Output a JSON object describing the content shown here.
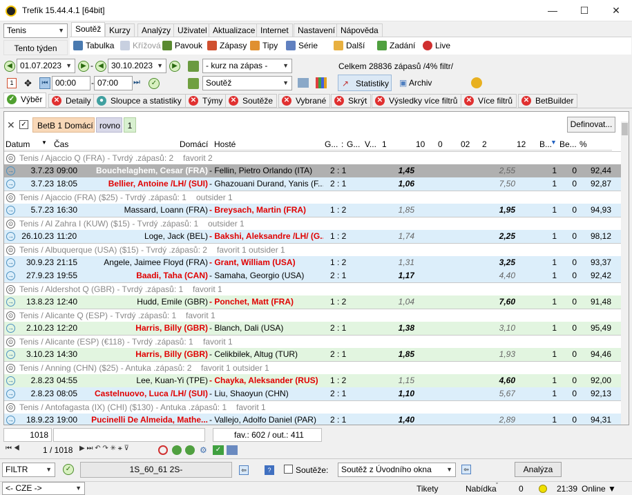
{
  "window": {
    "title": "Trefík 15.44.4.1 [64bit]"
  },
  "sport": {
    "value": "Tenis"
  },
  "week_label": "Tento týden",
  "tabs": [
    "Soutěž",
    "Kurzy",
    "Analýzy",
    "Uživatel",
    "Aktualizace",
    "Internet",
    "Nastavení",
    "Nápověda"
  ],
  "ribbon": [
    "Tabulka",
    "Křížová",
    "Pavouk",
    "Zápasy",
    "Tipy",
    "Série",
    "Další",
    "Zadání",
    "Live"
  ],
  "dates": {
    "from": "01.07.2023",
    "to": "30.10.2023",
    "time_from": "00:00",
    "time_to": "07:00"
  },
  "kurz_select": "- kurz na zápas -",
  "soutez_select": "Soutěž",
  "summary": "Celkem 28836 zápasů /4% filtr/",
  "stats_btn": "Statistiky",
  "archiv_btn": "Archiv",
  "filter_tabs": [
    "Výběr",
    "Detaily",
    "Sloupce a statistiky",
    "Týmy",
    "Soutěže",
    "Vybrané",
    "Skrýt",
    "Výsledky více filtrů",
    "Více filtrů",
    "BetBuilder"
  ],
  "chips": {
    "c1": "BetB 1 Domácí",
    "c2": "rovno",
    "c3": "1",
    "define_btn": "Definovat..."
  },
  "columns": [
    "Datum",
    "Čas",
    "Domácí",
    "Hosté",
    "G...",
    ":",
    "G...",
    "V...",
    "1",
    "10",
    "0",
    "02",
    "2",
    "12",
    "B...",
    "Be...",
    "%"
  ],
  "rows": [
    {
      "t": "g",
      "text": "Tenis / Ajaccio Q (FRA) - Tvrdý .zápasů: 2",
      "extra": "favorit 2"
    },
    {
      "t": "m",
      "bg": "sel",
      "d": "3.7.23",
      "time": "09:00",
      "home": "Bouchelaghem, Cesar (FRA)",
      "away": "- Fellin, Pietro Orlando (ITA)",
      "score": "2 : 1",
      "k1": "1,45",
      "k2": "2,55",
      "b": "1",
      "be": "0",
      "pct": "92,44",
      "hr": false,
      "ar": false,
      "k1b": true,
      "k2b": false,
      "hw": true
    },
    {
      "t": "m",
      "bg": "blue",
      "d": "3.7.23",
      "time": "18:05",
      "home": "Bellier, Antoine /LH/ (SUI)",
      "away": "- Ghazouani Durand, Yanis (F...",
      "score": "2 : 1",
      "k1": "1,06",
      "k2": "7,50",
      "b": "1",
      "be": "0",
      "pct": "92,87",
      "hr": true,
      "ar": false,
      "k1b": true,
      "k2b": false
    },
    {
      "t": "g",
      "text": "Tenis / Ajaccio (FRA) ($25) - Tvrdý .zápasů: 1",
      "extra": "outsider 1"
    },
    {
      "t": "m",
      "bg": "blue",
      "d": "5.7.23",
      "time": "16:30",
      "home": "Massard, Loann (FRA)",
      "away": "- Breysach, Martin (FRA)",
      "score": "1 : 2",
      "k1": "1,85",
      "k2": "1,95",
      "b": "1",
      "be": "0",
      "pct": "94,93",
      "hr": false,
      "ar": true,
      "k1b": false,
      "k2b": true
    },
    {
      "t": "g",
      "text": "Tenis / Al Zahra I (KUW) ($15) - Tvrdý .zápasů: 1",
      "extra": "outsider 1"
    },
    {
      "t": "m",
      "bg": "blue",
      "d": "26.10.23",
      "time": "11:20",
      "home": "Loge, Jack (BEL)",
      "away": "- Bakshi, Aleksandre /LH/ (G...",
      "score": "1 : 2",
      "k1": "1,74",
      "k2": "2,25",
      "b": "1",
      "be": "0",
      "pct": "98,12",
      "hr": false,
      "ar": true,
      "k1b": false,
      "k2b": true
    },
    {
      "t": "g",
      "text": "Tenis / Albuquerque (USA) ($15) - Tvrdý .zápasů: 2",
      "extra": "favorit 1  outsider 1"
    },
    {
      "t": "m",
      "bg": "blue",
      "d": "30.9.23",
      "time": "21:15",
      "home": "Angele, Jaimee Floyd (FRA)",
      "away": "- Grant, William (USA)",
      "score": "1 : 2",
      "k1": "1,31",
      "k2": "3,25",
      "b": "1",
      "be": "0",
      "pct": "93,37",
      "hr": false,
      "ar": true,
      "k1b": false,
      "k2b": true
    },
    {
      "t": "m",
      "bg": "blue",
      "d": "27.9.23",
      "time": "19:55",
      "home": "Baadi, Taha (CAN)",
      "away": "- Samaha, Georgio (USA)",
      "score": "2 : 1",
      "k1": "1,17",
      "k2": "4,40",
      "b": "1",
      "be": "0",
      "pct": "92,42",
      "hr": true,
      "ar": false,
      "k1b": true,
      "k2b": false
    },
    {
      "t": "g",
      "text": "Tenis / Aldershot Q (GBR) - Tvrdý .zápasů: 1",
      "extra": "favorit 1"
    },
    {
      "t": "m",
      "bg": "green",
      "d": "13.8.23",
      "time": "12:40",
      "home": "Hudd, Emile (GBR)",
      "away": "- Ponchet, Matt (FRA)",
      "score": "1 : 2",
      "k1": "1,04",
      "k2": "7,60",
      "b": "1",
      "be": "0",
      "pct": "91,48",
      "hr": false,
      "ar": true,
      "k1b": false,
      "k2b": true
    },
    {
      "t": "g",
      "text": "Tenis / Alicante Q (ESP) - Tvrdý .zápasů: 1",
      "extra": "favorit 1"
    },
    {
      "t": "m",
      "bg": "green",
      "d": "2.10.23",
      "time": "12:20",
      "home": "Harris, Billy (GBR)",
      "away": "- Blanch, Dali (USA)",
      "score": "2 : 1",
      "k1": "1,38",
      "k2": "3,10",
      "b": "1",
      "be": "0",
      "pct": "95,49",
      "hr": true,
      "ar": false,
      "k1b": true,
      "k2b": false
    },
    {
      "t": "g",
      "text": "Tenis / Alicante (ESP) (€118) - Tvrdý .zápasů: 1",
      "extra": "favorit 1"
    },
    {
      "t": "m",
      "bg": "green",
      "d": "3.10.23",
      "time": "14:30",
      "home": "Harris, Billy (GBR)",
      "away": "- Celikbilek, Altug (TUR)",
      "score": "2 : 1",
      "k1": "1,85",
      "k2": "1,93",
      "b": "1",
      "be": "0",
      "pct": "94,46",
      "hr": true,
      "ar": false,
      "k1b": true,
      "k2b": false
    },
    {
      "t": "g",
      "text": "Tenis / Anning (CHN) ($25) - Antuka .zápasů: 2",
      "extra": "favorit 1  outsider 1"
    },
    {
      "t": "m",
      "bg": "green",
      "d": "2.8.23",
      "time": "04:55",
      "home": "Lee, Kuan-Yi (TPE)",
      "away": "- Chayka, Aleksander (RUS)",
      "score": "1 : 2",
      "k1": "1,15",
      "k2": "4,60",
      "b": "1",
      "be": "0",
      "pct": "92,00",
      "hr": false,
      "ar": true,
      "k1b": false,
      "k2b": true
    },
    {
      "t": "m",
      "bg": "blue",
      "d": "2.8.23",
      "time": "08:05",
      "home": "Castelnuovo, Luca /LH/ (SUI)",
      "away": "- Liu, Shaoyun (CHN)",
      "score": "2 : 1",
      "k1": "1,10",
      "k2": "5,67",
      "b": "1",
      "be": "0",
      "pct": "92,13",
      "hr": true,
      "ar": false,
      "k1b": true,
      "k2b": false
    },
    {
      "t": "g",
      "text": "Tenis / Antofagasta (IX) (CHI) ($130) - Antuka .zápasů: 1",
      "extra": "favorit 1"
    },
    {
      "t": "m",
      "bg": "blue",
      "d": "18.9.23",
      "time": "19:00",
      "home": "Pucinelli De Almeida, Mathe...",
      "away": "- Vallejo, Adolfo Daniel (PAR)",
      "score": "2 : 1",
      "k1": "1,40",
      "k2": "2,89",
      "b": "1",
      "be": "0",
      "pct": "94,31",
      "hr": true,
      "ar": false,
      "k1b": true,
      "k2b": false
    }
  ],
  "footer": {
    "count": "1018",
    "favout": "fav.: 602 / out.: 411",
    "pager": "1 / 1018"
  },
  "bottom": {
    "filtr": "FILTR",
    "code": "1S_60_61 2S-",
    "souteze_label": "Soutěže:",
    "souteze_select": "Soutěž z Úvodního okna",
    "analyza_btn": "Analýza"
  },
  "status": {
    "lang": "<- CZE ->",
    "tikety": "Tikety",
    "nabidka": "Nabídka",
    "count": "0",
    "time": "21:39",
    "online": "Online"
  }
}
